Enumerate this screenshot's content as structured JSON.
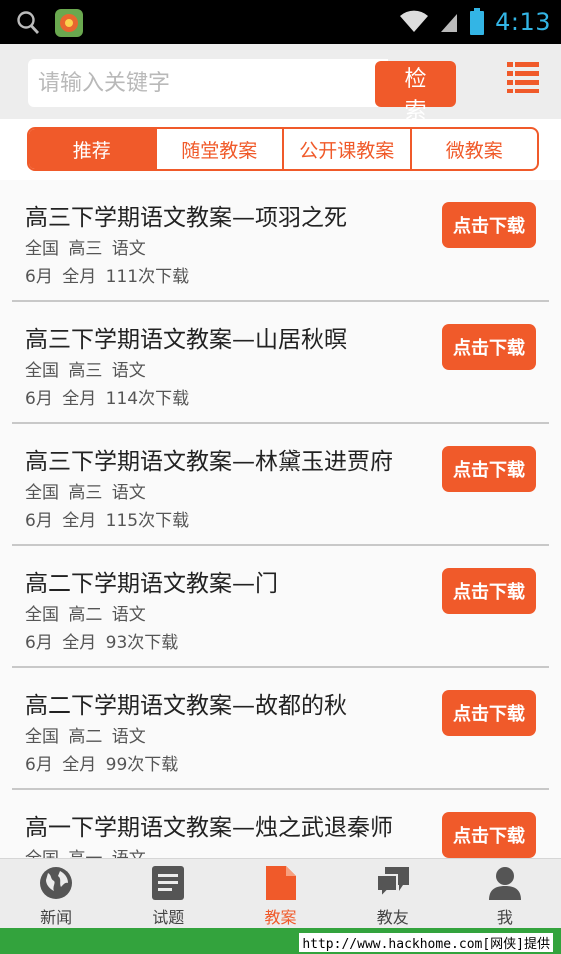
{
  "status_bar": {
    "time": "4:13"
  },
  "search": {
    "placeholder": "请输入关键字",
    "button_label": "检 索"
  },
  "tabs": [
    {
      "label": "推荐",
      "active": true
    },
    {
      "label": "随堂教案",
      "active": false
    },
    {
      "label": "公开课教案",
      "active": false
    },
    {
      "label": "微教案",
      "active": false
    }
  ],
  "items": [
    {
      "title": "高三下学期语文教案—项羽之死",
      "meta": "全国 高三 语文",
      "meta2": "6月 全月 111次下载",
      "button": "点击下载"
    },
    {
      "title": "高三下学期语文教案—山居秋暝",
      "meta": "全国 高三 语文",
      "meta2": "6月 全月 114次下载",
      "button": "点击下载"
    },
    {
      "title": "高三下学期语文教案—林黛玉进贾府",
      "meta": "全国 高三 语文",
      "meta2": "6月 全月 115次下载",
      "button": "点击下载"
    },
    {
      "title": "高二下学期语文教案—门",
      "meta": "全国 高二 语文",
      "meta2": "6月 全月 93次下载",
      "button": "点击下载"
    },
    {
      "title": "高二下学期语文教案—故都的秋",
      "meta": "全国 高二 语文",
      "meta2": "6月 全月 99次下载",
      "button": "点击下载"
    },
    {
      "title": "高一下学期语文教案—烛之武退秦师",
      "meta": "全国 高一 语文",
      "meta2": "",
      "button": "点击下载"
    }
  ],
  "bottom_nav": [
    {
      "label": "新闻",
      "icon": "globe-icon",
      "active": false
    },
    {
      "label": "试题",
      "icon": "notepad-icon",
      "active": false
    },
    {
      "label": "教案",
      "icon": "document-icon",
      "active": true
    },
    {
      "label": "教友",
      "icon": "chat-bubbles-icon",
      "active": false
    },
    {
      "label": "我",
      "icon": "user-icon",
      "active": false
    }
  ],
  "watermark": "http://www.hackhome.com[网侠]提供",
  "colors": {
    "accent": "#f05a2a",
    "status_clock": "#33b5e5",
    "watermark_bar": "#33a33d"
  }
}
